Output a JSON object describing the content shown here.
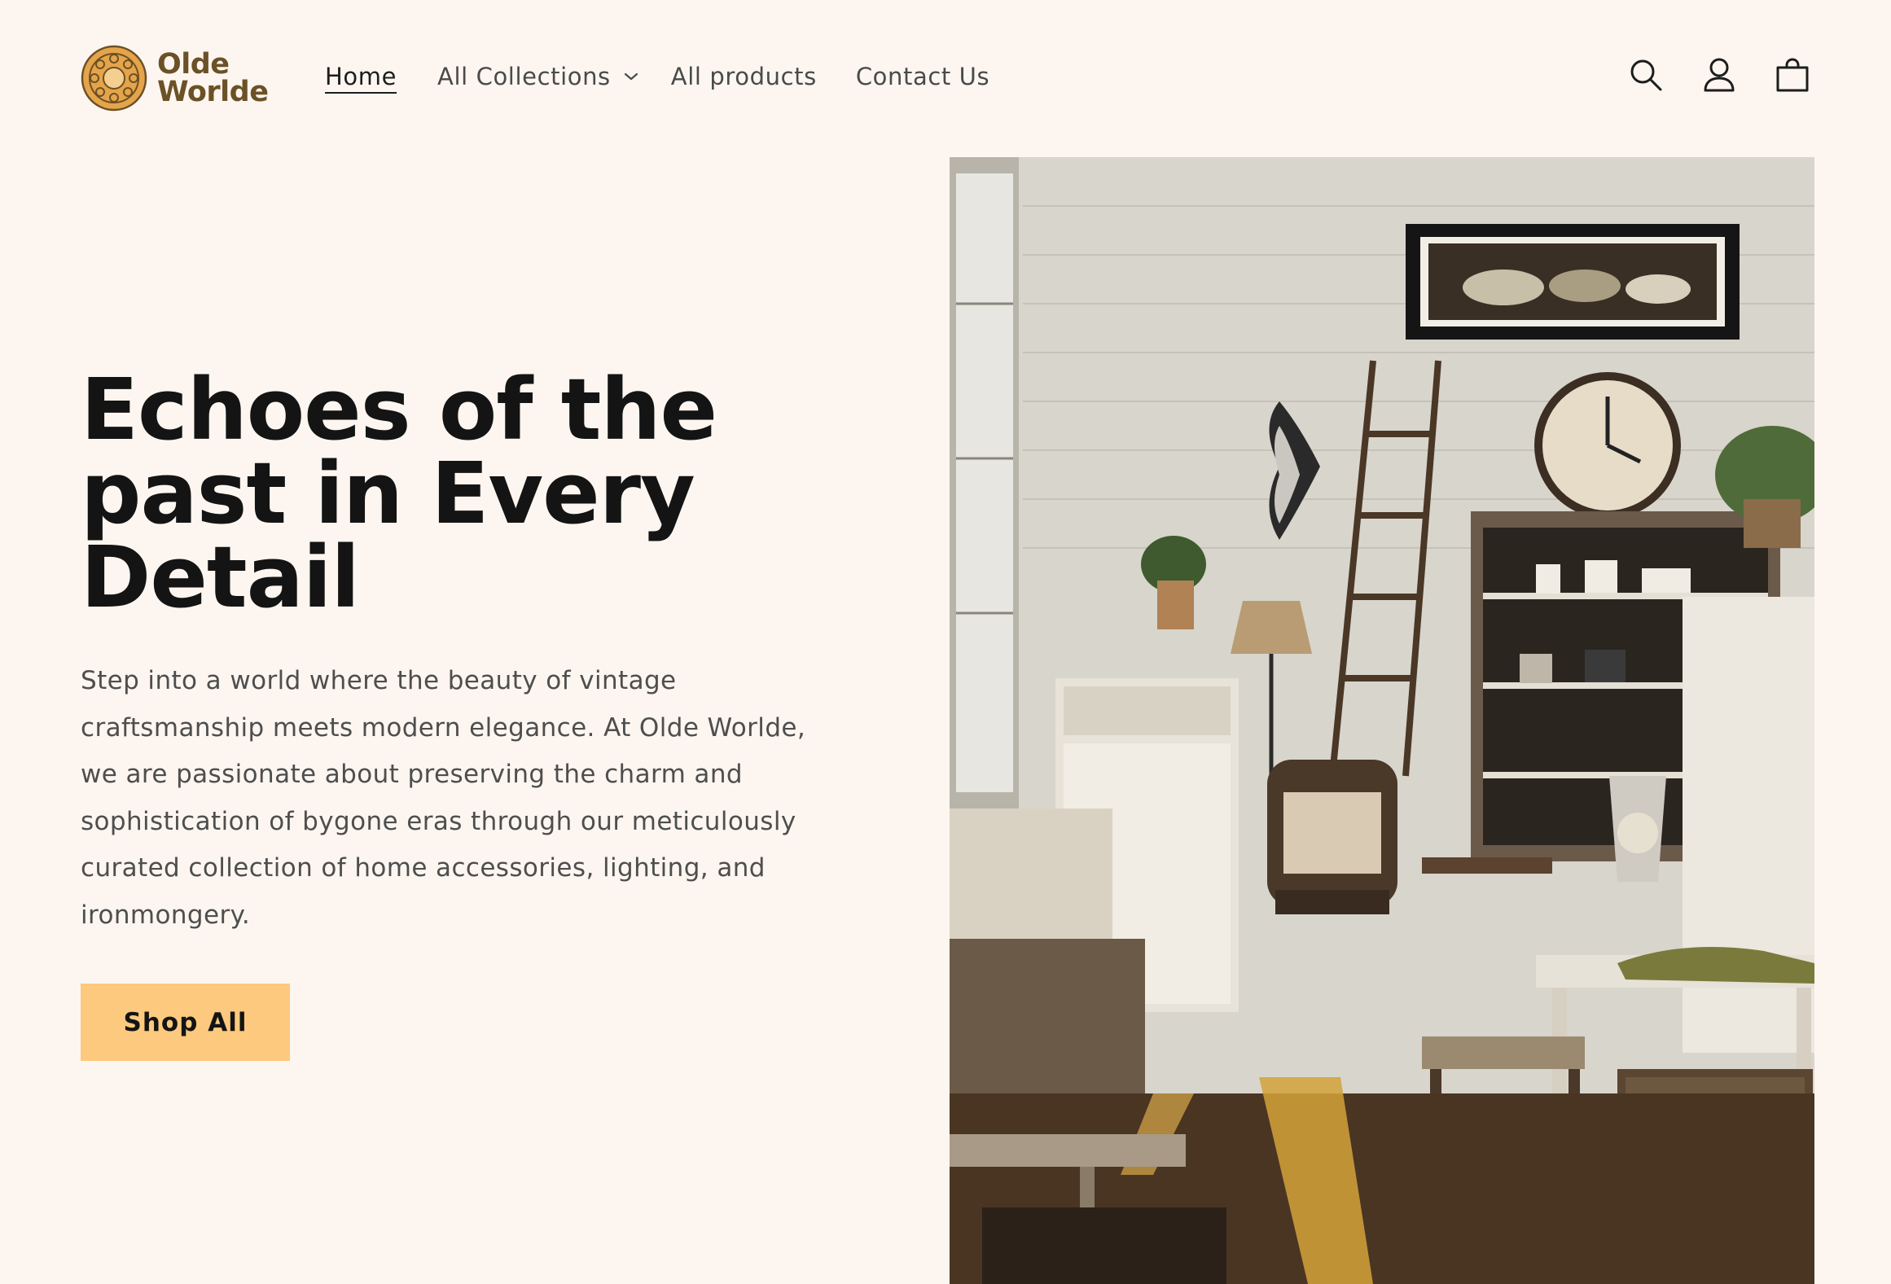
{
  "brand": {
    "name_line1": "Olde",
    "name_line2": "Worlde"
  },
  "nav": {
    "home": "Home",
    "collections": "All Collections",
    "products": "All products",
    "contact": "Contact Us"
  },
  "hero": {
    "title": "Echoes of the past in Every Detail",
    "description": "Step into a world where the beauty of vintage craftsmanship meets modern elegance. At Olde Worlde, we are passionate about preserving the charm and sophistication of bygone eras through our meticulously curated collection of home accessories, lighting, and ironmongery.",
    "cta_label": "Shop All"
  },
  "icons": {
    "search": "search-icon",
    "account": "user-icon",
    "cart": "cart-icon",
    "dropdown": "chevron-down-icon"
  },
  "colors": {
    "background": "#fdf6f0",
    "cta": "#fdc97e",
    "brand": "#6b5126",
    "text": "#141414"
  }
}
